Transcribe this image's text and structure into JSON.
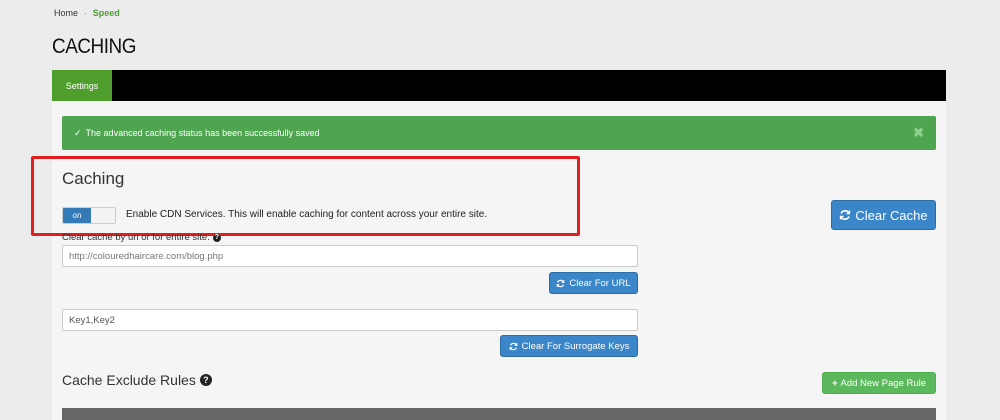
{
  "breadcrumb": {
    "home": "Home",
    "separator": "·",
    "current": "Speed"
  },
  "page_title": "CACHING",
  "tabs": [
    {
      "label": "Settings",
      "active": true
    }
  ],
  "alert": {
    "message": "The advanced caching status has been successfully saved",
    "icon": "check-icon",
    "close_icon": "close-icon",
    "color": "#4ea44f"
  },
  "caching": {
    "title": "Caching",
    "toggle": {
      "state_label": "on",
      "enabled": true
    },
    "toggle_description": "Enable CDN Services. This will enable caching for content across your entire site.",
    "clear_cache_label": "Clear Cache"
  },
  "clear_by_url": {
    "label": "Clear cache by url or for entire site.",
    "placeholder": "http://colouredhaircare.com/blog.php",
    "button_label": "Clear For URL"
  },
  "surrogate_keys": {
    "placeholder": "Key1,Key2",
    "button_label": "Clear For Surrogate Keys"
  },
  "exclude_rules": {
    "title": "Cache Exclude Rules",
    "add_button_label": "Add New Page Rule"
  },
  "colors": {
    "accent_green": "#4f9e2d",
    "button_blue": "#3a86c8",
    "highlight_red": "#e02020"
  }
}
